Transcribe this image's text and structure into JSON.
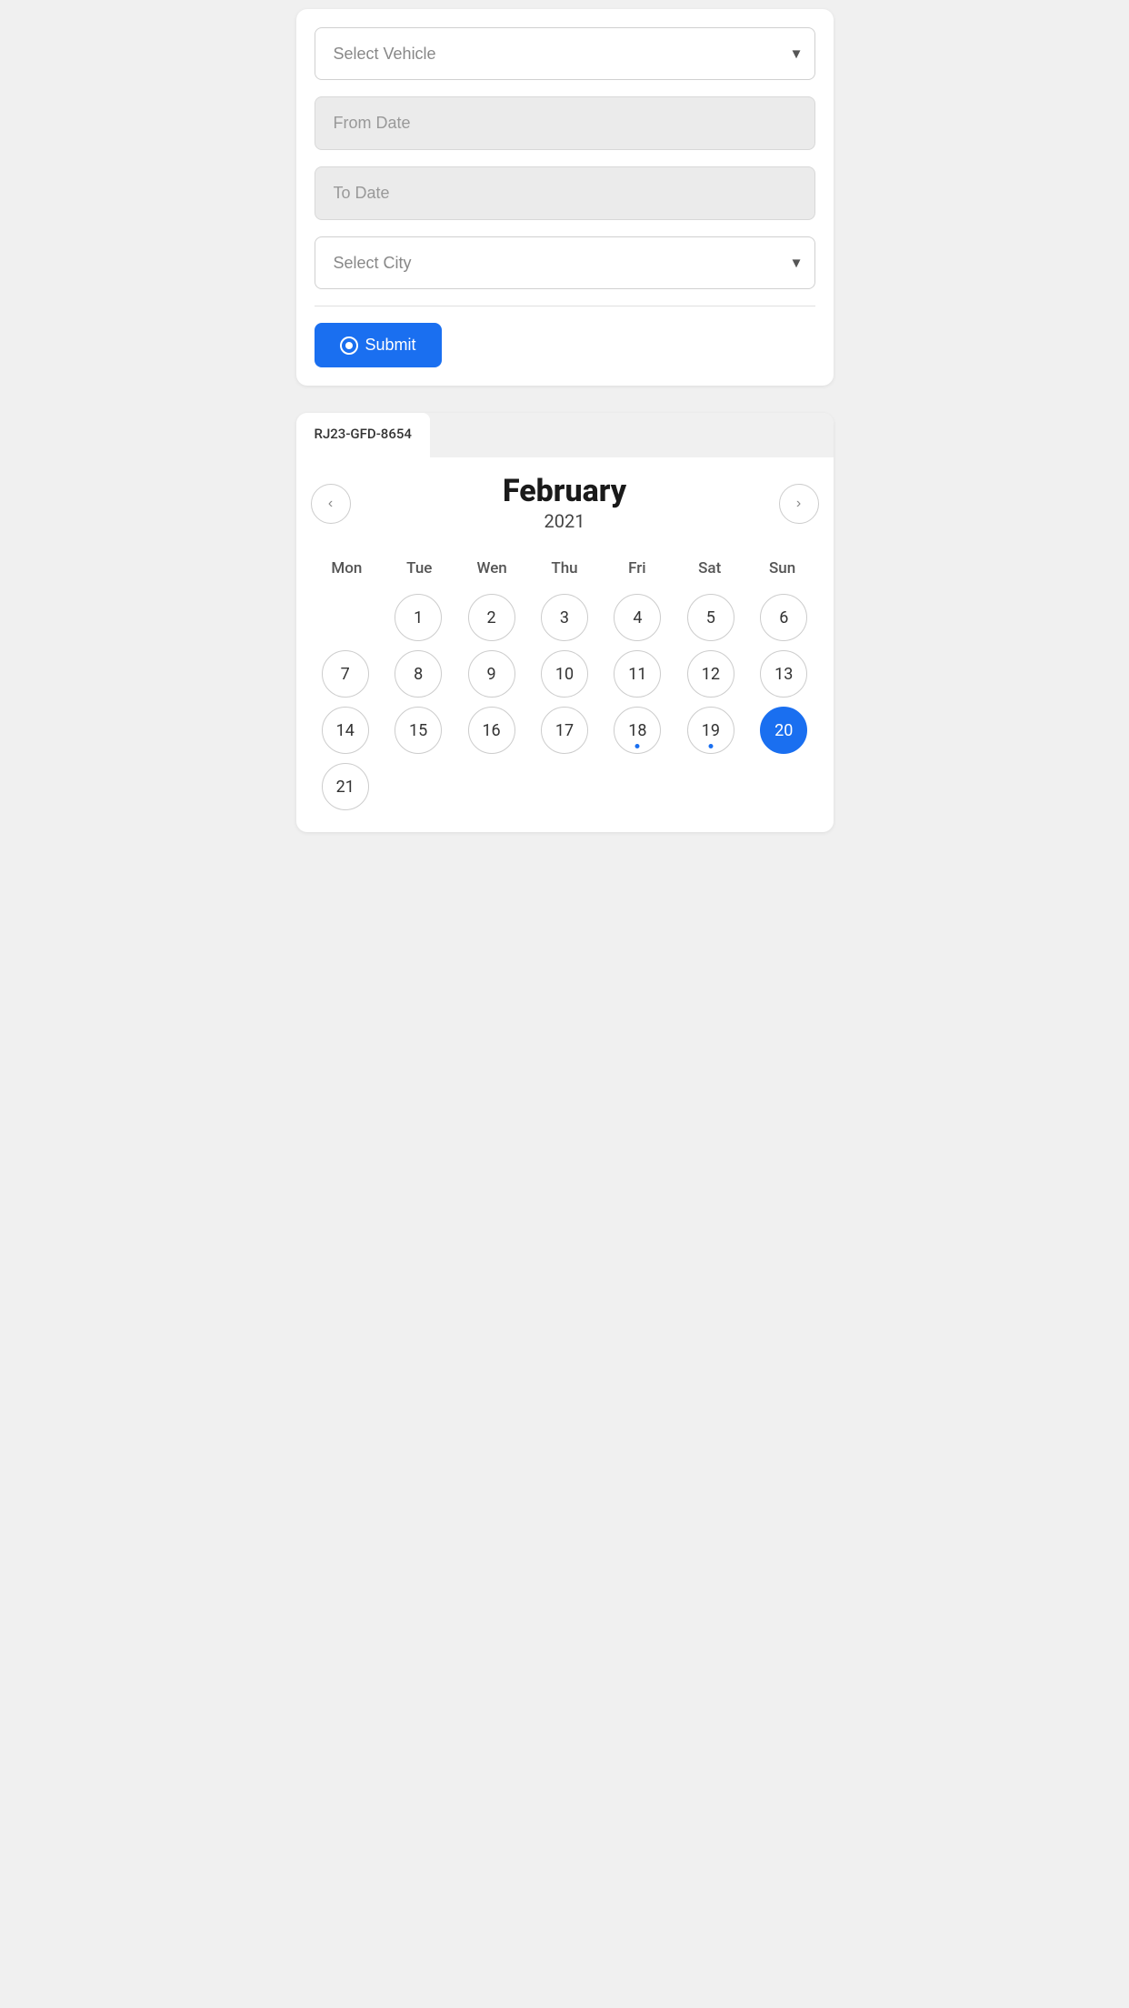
{
  "form": {
    "select_vehicle_placeholder": "Select Vehicle",
    "from_date_placeholder": "From Date",
    "to_date_placeholder": "To Date",
    "select_city_placeholder": "Select City",
    "submit_label": "Submit"
  },
  "tab": {
    "label": "RJ23-GFD-8654"
  },
  "calendar": {
    "month": "February",
    "year": "2021",
    "day_headers": [
      "Mon",
      "Tue",
      "Wen",
      "Thu",
      "Fri",
      "Sat",
      "Sun"
    ],
    "prev_label": "‹",
    "next_label": "›",
    "weeks": [
      [
        {
          "num": "",
          "empty": true
        },
        {
          "num": 1
        },
        {
          "num": 2
        },
        {
          "num": 3
        },
        {
          "num": 4
        },
        {
          "num": 5
        },
        {
          "num": 6
        },
        {
          "num": 7
        }
      ],
      [
        {
          "num": 8
        },
        {
          "num": 9
        },
        {
          "num": 10
        },
        {
          "num": 11
        },
        {
          "num": 12
        },
        {
          "num": 13
        },
        {
          "num": 14
        }
      ],
      [
        {
          "num": 15
        },
        {
          "num": 16
        },
        {
          "num": 17
        },
        {
          "num": 18,
          "dot": true
        },
        {
          "num": 19,
          "dot": true
        },
        {
          "num": 20,
          "selected": true
        },
        {
          "num": 21
        }
      ]
    ],
    "days": [
      {
        "num": "",
        "empty": true
      },
      {
        "num": "1"
      },
      {
        "num": "2"
      },
      {
        "num": "3"
      },
      {
        "num": "4"
      },
      {
        "num": "5"
      },
      {
        "num": "6"
      },
      {
        "num": "7"
      },
      {
        "num": "8"
      },
      {
        "num": "9"
      },
      {
        "num": "10"
      },
      {
        "num": "11"
      },
      {
        "num": "12"
      },
      {
        "num": "13"
      },
      {
        "num": "14"
      },
      {
        "num": "15"
      },
      {
        "num": "16"
      },
      {
        "num": "17"
      },
      {
        "num": "18",
        "dot": true
      },
      {
        "num": "19",
        "dot": true
      },
      {
        "num": "20",
        "selected": true
      },
      {
        "num": "21"
      }
    ]
  }
}
